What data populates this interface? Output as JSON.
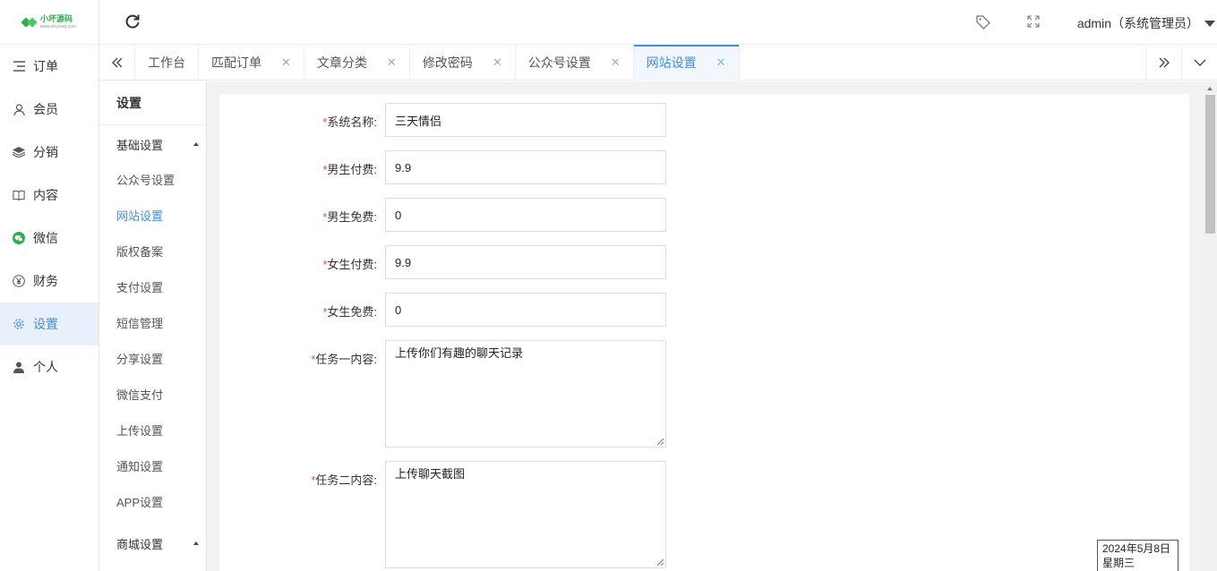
{
  "brand": {
    "name": "小坏源码",
    "sub": "www.xhymsq.com"
  },
  "nav": {
    "items": [
      {
        "label": "订单",
        "icon": "list-icon"
      },
      {
        "label": "会员",
        "icon": "user-outline-icon"
      },
      {
        "label": "分销",
        "icon": "layers-icon"
      },
      {
        "label": "内容",
        "icon": "book-icon"
      },
      {
        "label": "微信",
        "icon": "wechat-icon"
      },
      {
        "label": "财务",
        "icon": "yen-icon"
      },
      {
        "label": "设置",
        "icon": "gear-icon"
      },
      {
        "label": "个人",
        "icon": "person-icon"
      }
    ],
    "active_index": 6
  },
  "header": {
    "user": "admin（系统管理员）"
  },
  "tabs": [
    {
      "label": "工作台",
      "closable": false
    },
    {
      "label": "匹配订单",
      "closable": true
    },
    {
      "label": "文章分类",
      "closable": true
    },
    {
      "label": "修改密码",
      "closable": true
    },
    {
      "label": "公众号设置",
      "closable": true
    },
    {
      "label": "网站设置",
      "closable": true,
      "active": true
    }
  ],
  "submenu": {
    "title": "设置",
    "group1": "基础设置",
    "items": [
      "公众号设置",
      "网站设置",
      "版权备案",
      "支付设置",
      "短信管理",
      "分享设置",
      "微信支付",
      "上传设置",
      "通知设置",
      "APP设置"
    ],
    "active": "网站设置",
    "group2": "商城设置"
  },
  "form": {
    "required_mark": "*",
    "fields": [
      {
        "label": "系统名称:",
        "value": "三天情侣"
      },
      {
        "label": "男生付费:",
        "value": "9.9"
      },
      {
        "label": "男生免费:",
        "value": "0"
      },
      {
        "label": "女生付费:",
        "value": "9.9"
      },
      {
        "label": "女生免费:",
        "value": "0"
      }
    ],
    "areas": [
      {
        "label": "任务一内容:",
        "value": "上传你们有趣的聊天记录"
      },
      {
        "label": "任务二内容:",
        "value": "上传聊天截图"
      }
    ]
  },
  "date": {
    "line1": "2024年5月8日",
    "line2": "星期三"
  },
  "colors": {
    "accent": "#3c8ee6",
    "required": "#e74c3c",
    "brand": "#2fae4f"
  }
}
